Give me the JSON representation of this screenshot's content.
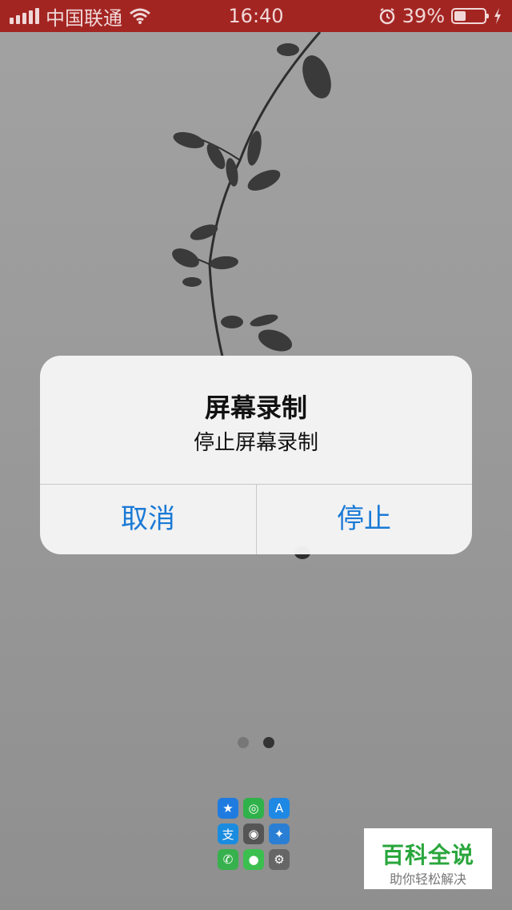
{
  "status_bar": {
    "carrier": "中国联通",
    "time": "16:40",
    "battery_percent": "39%",
    "battery_level": 0.39,
    "icons": [
      "signal-icon",
      "wifi-icon",
      "alarm-icon",
      "battery-icon",
      "charging-icon"
    ],
    "background_color": "#a32522"
  },
  "alert": {
    "title": "屏幕录制",
    "message": "停止屏幕录制",
    "cancel_label": "取消",
    "stop_label": "停止",
    "button_color": "#1a7ad6"
  },
  "page_indicator": {
    "count": 2,
    "current": 2
  },
  "dock_folder": {
    "apps": [
      "app-store-icon",
      "wechat-icon",
      "app-store-a-icon",
      "alipay-icon",
      "camera-icon",
      "safari-icon",
      "phone-icon",
      "messages-icon",
      "settings-icon"
    ]
  },
  "watermark": {
    "title": "百科全说",
    "subtitle": "助你轻松解决"
  }
}
